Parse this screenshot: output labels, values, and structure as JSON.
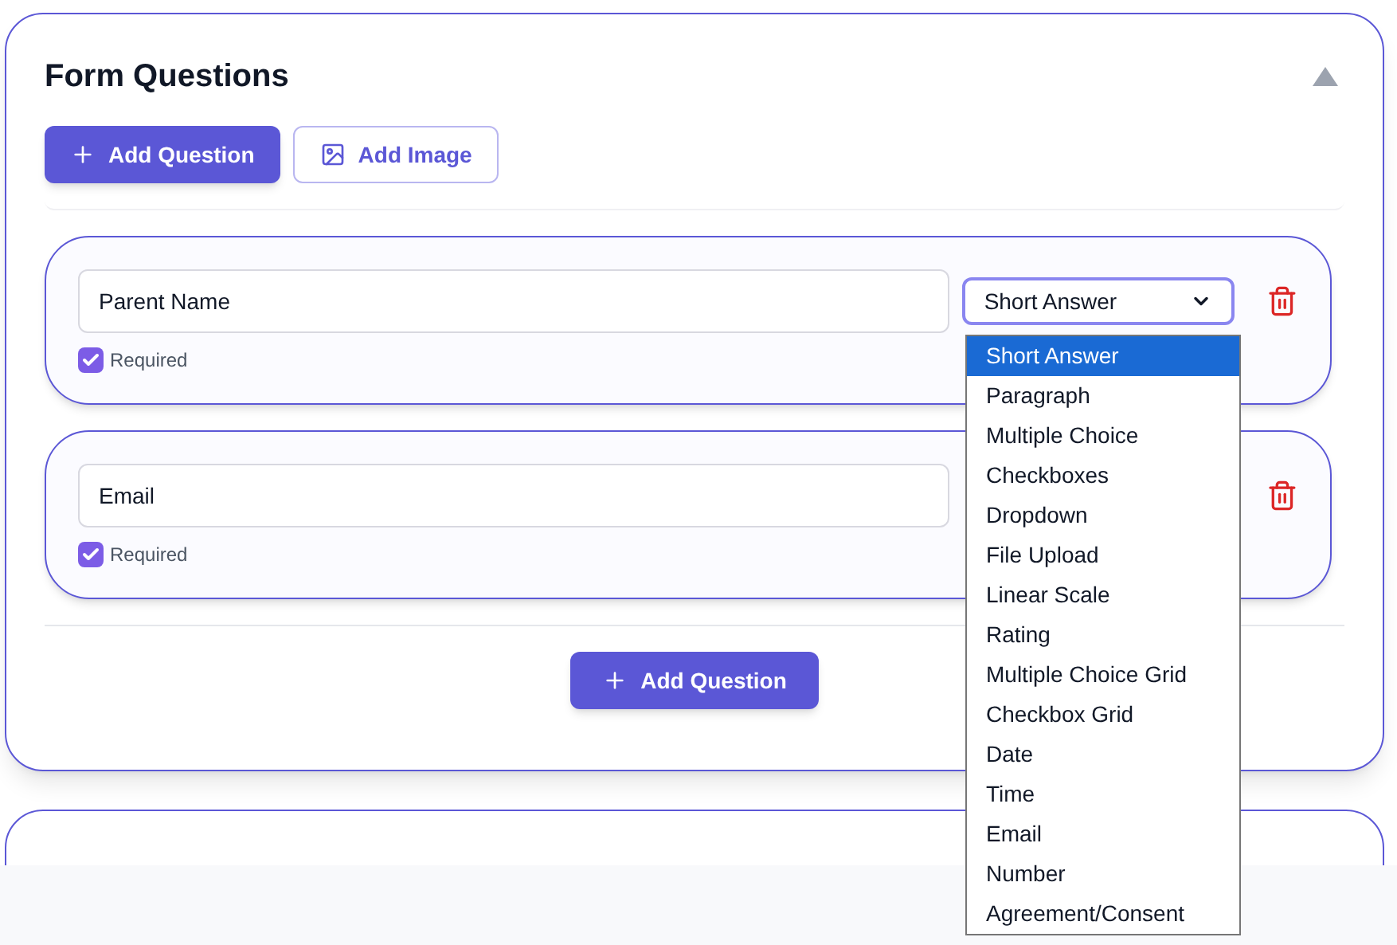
{
  "section": {
    "title": "Form Questions",
    "expanded": true
  },
  "toolbar": [
    {
      "kind": "primary",
      "label": "Add Question"
    },
    {
      "kind": "outline",
      "label": "Add Image"
    }
  ],
  "questions": [
    {
      "value": "Parent Name",
      "required": true,
      "required_label": "Required",
      "type": "Short Answer"
    },
    {
      "value": "Email",
      "required": true,
      "required_label": "Required"
    }
  ],
  "dropdown": {
    "options": [
      {
        "label": "Short Answer",
        "selected": true
      },
      {
        "label": "Paragraph",
        "selected": false
      },
      {
        "label": "Multiple Choice",
        "selected": false
      },
      {
        "label": "Checkboxes",
        "selected": false
      },
      {
        "label": "Dropdown",
        "selected": false
      },
      {
        "label": "File Upload",
        "selected": false
      },
      {
        "label": "Linear Scale",
        "selected": false
      },
      {
        "label": "Rating",
        "selected": false
      },
      {
        "label": "Multiple Choice Grid",
        "selected": false
      },
      {
        "label": "Checkbox Grid",
        "selected": false
      },
      {
        "label": "Date",
        "selected": false
      },
      {
        "label": "Time",
        "selected": false
      },
      {
        "label": "Email",
        "selected": false
      },
      {
        "label": "Number",
        "selected": false
      },
      {
        "label": "Agreement/Consent",
        "selected": false
      }
    ]
  },
  "footer_button": {
    "label": "Add Question"
  }
}
